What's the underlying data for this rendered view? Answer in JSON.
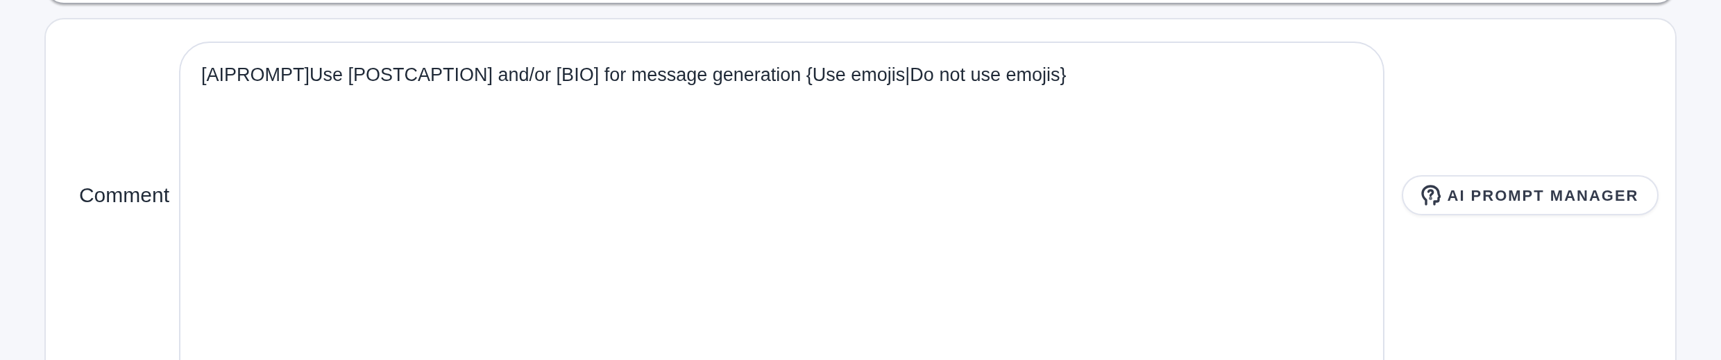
{
  "comment": {
    "label": "Comment",
    "value": "[AIPROMPT]Use [POSTCAPTION] and/or [BIO] for message generation {Use emojis|Do not use emojis}"
  },
  "button": {
    "label": "AI PROMPT MANAGER"
  }
}
